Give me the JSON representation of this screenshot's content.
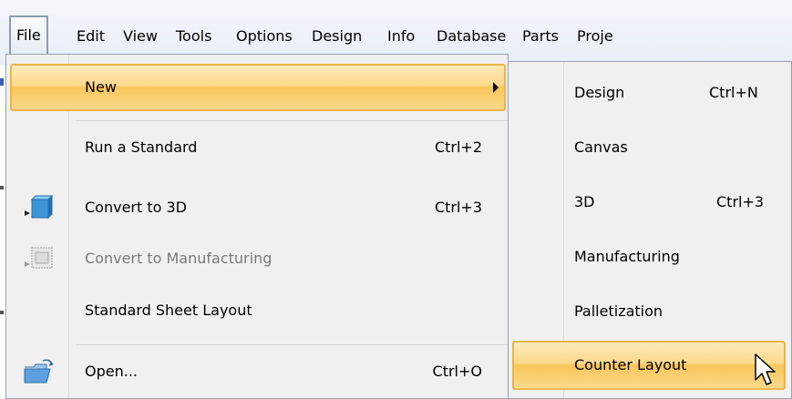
{
  "menubar": {
    "items": [
      {
        "label": "File"
      },
      {
        "label": "Edit"
      },
      {
        "label": "View"
      },
      {
        "label": "Tools"
      },
      {
        "label": "Options"
      },
      {
        "label": "Design"
      },
      {
        "label": "Info"
      },
      {
        "label": "Database"
      },
      {
        "label": "Parts"
      },
      {
        "label": "Proje"
      }
    ]
  },
  "file_menu": {
    "items": [
      {
        "label": "New",
        "shortcut": "",
        "has_submenu": true,
        "highlighted": true
      },
      {
        "label": "Run a Standard",
        "shortcut": "Ctrl+2"
      },
      {
        "label": "Convert to 3D",
        "shortcut": "Ctrl+3",
        "icon": "cube-convert-icon"
      },
      {
        "label": "Convert to Manufacturing",
        "shortcut": "",
        "disabled": true,
        "icon": "manufacturing-convert-icon"
      },
      {
        "label": "Standard Sheet Layout",
        "shortcut": ""
      },
      {
        "label": "Open...",
        "shortcut": "Ctrl+O",
        "icon": "open-folder-icon"
      }
    ]
  },
  "new_submenu": {
    "items": [
      {
        "label": "Design",
        "shortcut": "Ctrl+N"
      },
      {
        "label": "Canvas",
        "shortcut": ""
      },
      {
        "label": "3D",
        "shortcut": "Ctrl+3"
      },
      {
        "label": "Manufacturing",
        "shortcut": ""
      },
      {
        "label": "Palletization",
        "shortcut": ""
      },
      {
        "label": "Counter Layout",
        "shortcut": "",
        "highlighted": true
      }
    ]
  },
  "colors": {
    "highlight": "#f9c65a",
    "highlight_border": "#e9b64a",
    "menu_bg": "#f0f0f0",
    "disabled_text": "#7a7a7a"
  }
}
